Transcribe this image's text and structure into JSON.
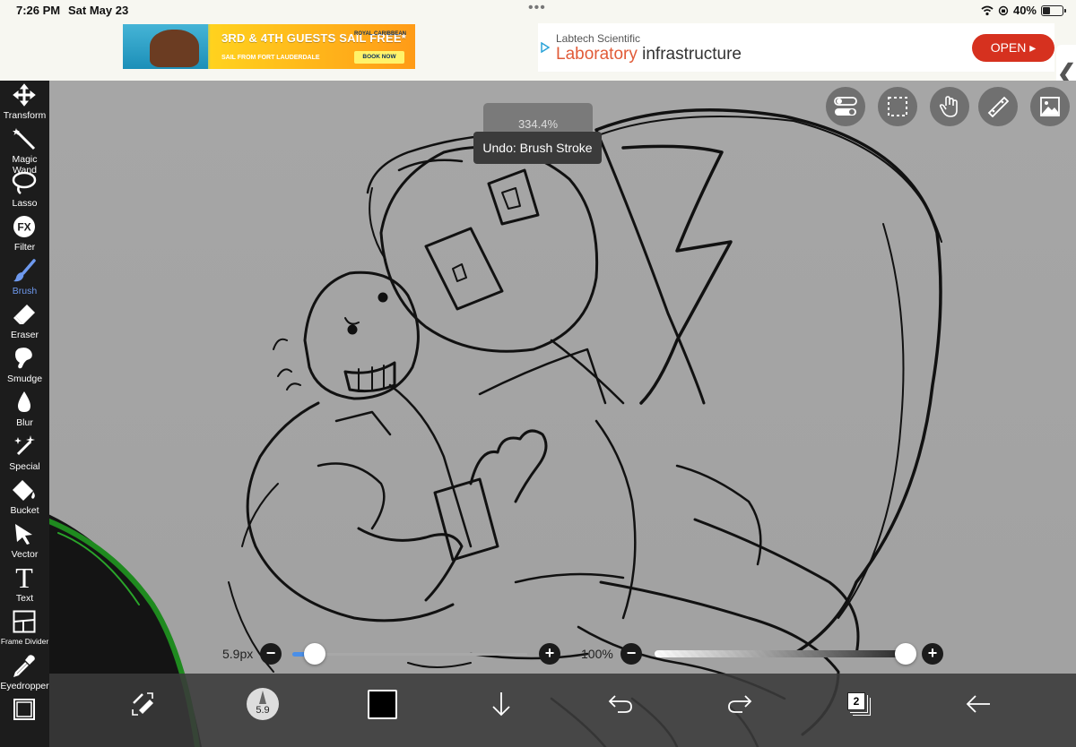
{
  "status": {
    "time": "7:26 PM",
    "date": "Sat May 23",
    "battery": "40%",
    "battery_level": 0.4
  },
  "ads": {
    "left": {
      "headline": "3RD & 4TH GUESTS SAIL FREE*",
      "sub": "SAIL FROM FORT LAUDERDALE",
      "brand": "ROYAL CARIBBEAN",
      "cta": "BOOK NOW"
    },
    "right": {
      "advertiser": "Labtech Scientific",
      "title_accent": "Laboratory",
      "title_rest": " infrastructure",
      "cta": "OPEN ▸"
    }
  },
  "tools": [
    {
      "label": "Transform",
      "icon": "transform-icon"
    },
    {
      "label": "Magic Wand",
      "icon": "magic-wand-icon"
    },
    {
      "label": "Lasso",
      "icon": "lasso-icon"
    },
    {
      "label": "Filter",
      "icon": "filter-icon"
    },
    {
      "label": "Brush",
      "icon": "brush-icon",
      "selected": true
    },
    {
      "label": "Eraser",
      "icon": "eraser-icon"
    },
    {
      "label": "Smudge",
      "icon": "smudge-icon"
    },
    {
      "label": "Blur",
      "icon": "blur-icon"
    },
    {
      "label": "Special",
      "icon": "special-icon"
    },
    {
      "label": "Bucket",
      "icon": "bucket-icon"
    },
    {
      "label": "Vector",
      "icon": "vector-icon"
    },
    {
      "label": "Text",
      "icon": "text-icon"
    },
    {
      "label": "Frame Divider",
      "icon": "frame-divider-icon"
    },
    {
      "label": "Eyedropper",
      "icon": "eyedropper-icon"
    }
  ],
  "canvas": {
    "zoom": "334.4%",
    "undo_toast": "Undo: Brush Stroke"
  },
  "quick_buttons": [
    "toggle-icon",
    "selection-icon",
    "hand-icon",
    "ruler-icon",
    "image-icon"
  ],
  "brush": {
    "size_label": "5.9px",
    "size_value": 5.9,
    "opacity_label": "100%",
    "opacity_value": 1.0,
    "thumb_size": "5.9"
  },
  "color": {
    "current": "#000000"
  },
  "layers": {
    "count": "2"
  },
  "accent": "#6e99ee"
}
